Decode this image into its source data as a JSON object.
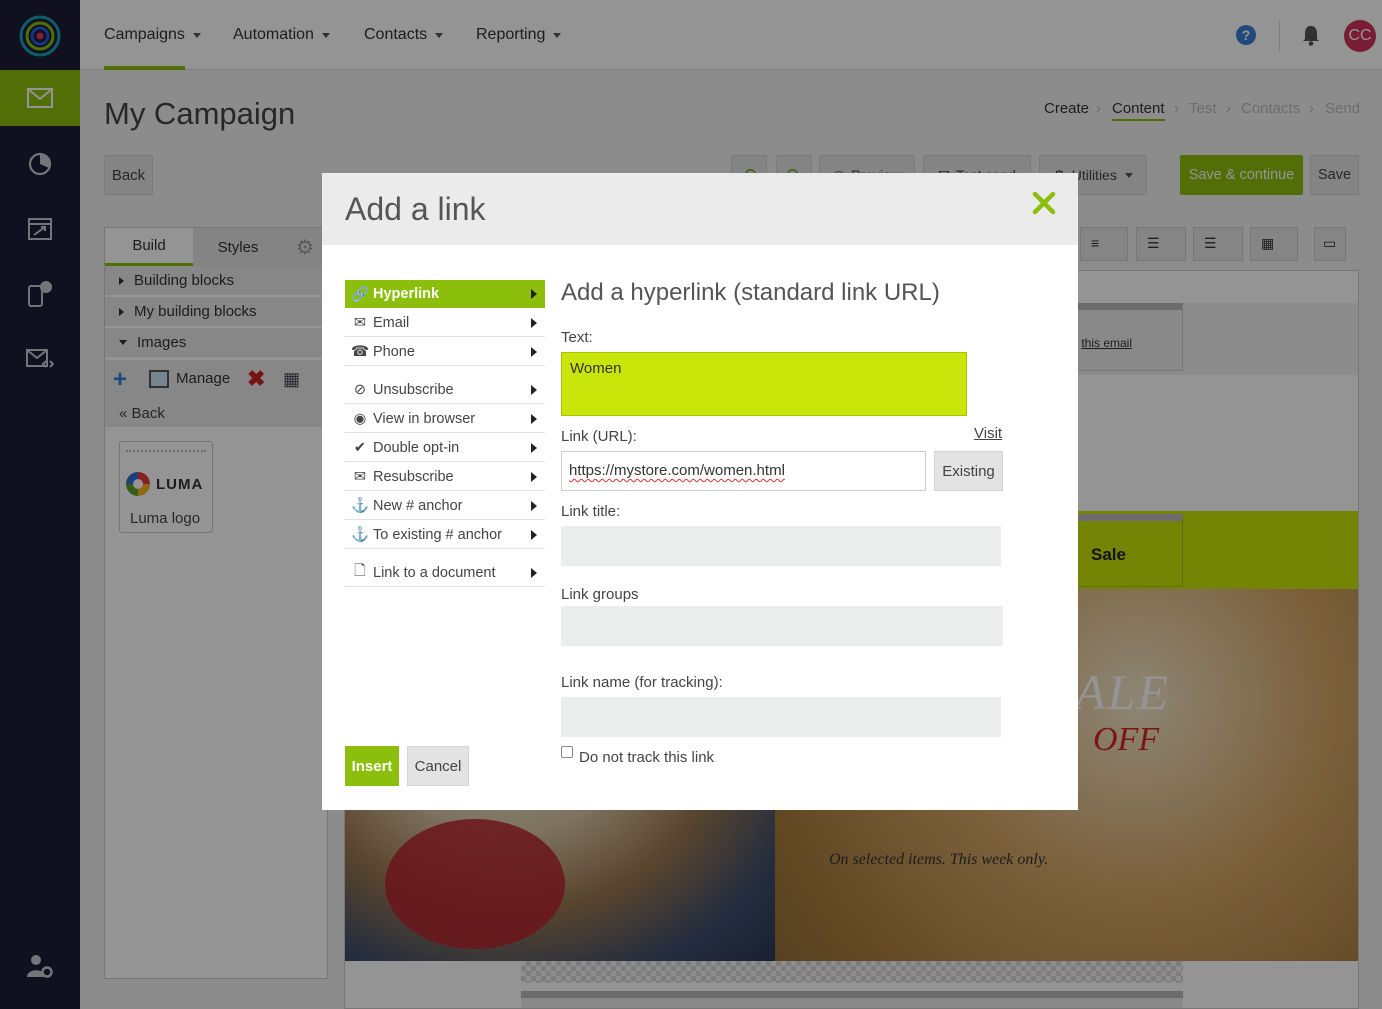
{
  "nav": {
    "items": [
      {
        "label": "Campaigns"
      },
      {
        "label": "Automation"
      },
      {
        "label": "Contacts"
      },
      {
        "label": "Reporting"
      }
    ],
    "avatar_initials": "CC"
  },
  "page": {
    "title": "My Campaign",
    "breadcrumb": [
      "Create",
      "Content",
      "Test",
      "Contacts",
      "Send"
    ]
  },
  "toolbar": {
    "back": "Back",
    "preview": "Preview",
    "test_send": "Test send",
    "utilities": "Utilities",
    "save_continue": "Save & continue",
    "save": "Save"
  },
  "left_panel": {
    "tabs": [
      "Build",
      "Styles"
    ],
    "sections": [
      "Building blocks",
      "My building blocks",
      "Images"
    ],
    "manage": "Manage",
    "back": "« Back",
    "luma_logo_text": "LUMA",
    "luma_caption": "Luma logo"
  },
  "canvas": {
    "view_email": "this email",
    "sale": "Sale",
    "hero_big": "ALE",
    "hero_off": "OFF",
    "hero_caption": "On selected items. This week only."
  },
  "modal": {
    "title": "Add a link",
    "link_types": [
      {
        "label": "Hyperlink"
      },
      {
        "label": "Email"
      },
      {
        "label": "Phone"
      },
      {
        "label": "Unsubscribe"
      },
      {
        "label": "View in browser"
      },
      {
        "label": "Double opt-in"
      },
      {
        "label": "Resubscribe"
      },
      {
        "label": "New # anchor"
      },
      {
        "label": "To existing # anchor"
      },
      {
        "label": "Link to a document"
      }
    ],
    "heading": "Add a hyperlink (standard link URL)",
    "text_label": "Text:",
    "text_value": "Women",
    "url_label": "Link (URL):",
    "visit": "Visit",
    "url_value": "https://mystore.com/women.html",
    "existing": "Existing",
    "title_label": "Link title:",
    "groups_label": "Link groups",
    "name_label": "Link name (for tracking):",
    "no_track": "Do not track this link",
    "insert": "Insert",
    "cancel": "Cancel"
  },
  "colors": {
    "accent": "#8cbf0b",
    "rail": "#1c1d38",
    "highlight_field": "#c8e60a",
    "avatar": "#d1325a"
  }
}
